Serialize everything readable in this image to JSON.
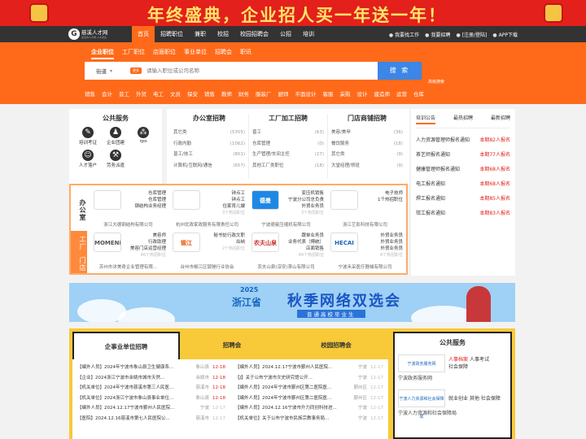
{
  "banner": {
    "text": "年终盛典，企业招人买一年送一年！"
  },
  "logo": {
    "title": "慈溪人才网",
    "slogan": "慈溪市人才网 人才就业"
  },
  "nav": [
    "首页",
    "招聘职位",
    "兼职",
    "校招",
    "校园招聘会",
    "公招",
    "培训"
  ],
  "user": [
    "我要找工作",
    "我要招聘",
    "[注册/登陆]",
    "APP下载"
  ],
  "search": {
    "tabs": [
      "企业职位",
      "工厂职位",
      "店面职位",
      "事业单位",
      "招聘会",
      "职讯"
    ],
    "city": "街道",
    "tag": "更多",
    "placeholder": "请输入职位或公司名称",
    "button": "搜 索",
    "advanced": "高级搜索"
  },
  "hotwords": [
    "销售",
    "会计",
    "普工",
    "外贸",
    "电工",
    "文员",
    "保安",
    "销售",
    "教师",
    "财务",
    "服装厂",
    "厨师",
    "平面设计",
    "客服",
    "采购",
    "设计",
    "建造师",
    "运营",
    "仓库"
  ],
  "publicService": {
    "title": "公共服务",
    "items": [
      "培训考证",
      "企业团建",
      "rpo",
      "人才落户",
      "劳务派遣"
    ]
  },
  "categories": [
    {
      "title": "办公室招聘",
      "items": [
        [
          "其它类",
          "(5355)"
        ],
        [
          "行政内勤",
          "(1062)"
        ],
        [
          "普工/技工",
          "(801)"
        ],
        [
          "计算机/互联网/通信",
          "(657)"
        ]
      ]
    },
    {
      "title": "工厂加工招聘",
      "items": [
        [
          "普工",
          "(63)"
        ],
        [
          "仓库管理",
          "(0)"
        ],
        [
          "生产管理/车间主任",
          "(27)"
        ],
        [
          "其他工厂类职位",
          "(18)"
        ]
      ]
    },
    {
      "title": "门店商铺招聘",
      "items": [
        [
          "美容/美甲",
          "(36)"
        ],
        [
          "餐饮服务",
          "(18)"
        ],
        [
          "其它类",
          "(9)"
        ],
        [
          "大堂经理/领班",
          "(9)"
        ]
      ]
    }
  ],
  "training": {
    "tabs": [
      "培训公告",
      "最热招聘",
      "最新招聘"
    ],
    "items": [
      [
        "人力资源管理师报名通知",
        "本期82人报名"
      ],
      [
        "茶艺师报名通知",
        "本期77人报名"
      ],
      [
        "健康管理师报名通知",
        "本期68人报名"
      ],
      [
        "电工报名通知",
        "本期68人报名"
      ],
      [
        "焊工报名通知",
        "本期85人报名"
      ],
      [
        "钳工报名通知",
        "本期83人报名"
      ]
    ]
  },
  "jobs": {
    "tabs": [
      "办公室",
      "工厂",
      "门店"
    ],
    "cards": [
      {
        "logo": "",
        "pos": [
          "仓库管理",
          "仓库管理",
          "钢结构业务经理"
        ],
        "hint": "",
        "co": "浙江大德钢结构有限公司"
      },
      {
        "logo": "",
        "pos": [
          "钟点工",
          "钟点工",
          "住家育儿嫂"
        ],
        "hint": "3个热招职位",
        "co": "杭州优政家政服务有限责任公司"
      },
      {
        "logo": "德曼",
        "pos": [
          "变压机销售",
          "宁波分公司总负责",
          "外贸业务员"
        ],
        "hint": "3个热招职位",
        "co": "宁波德曼压缩机有限公司"
      },
      {
        "logo": "",
        "pos": [
          "电子技师",
          "",
          "1个热招职位"
        ],
        "hint": "",
        "co": "浙江艺影科技有限公司"
      },
      {
        "logo": "MOMENI",
        "pos": [
          "美容师",
          "行政助理",
          "美容门店运营经理"
        ],
        "hint": "46个热招职位",
        "co": "苏州市沐美奇企业管理有限..."
      },
      {
        "logo": "锻江",
        "pos": [
          "秘书处行政文职",
          "出纳"
        ],
        "hint": "2个热招职位",
        "co": "台州市椒江区锻锤行业协会"
      },
      {
        "logo": "农夫山泉",
        "pos": [
          "跟单业务员",
          "业务代表（傅统）",
          "店面销售"
        ],
        "hint": "49个热招职位",
        "co": "农夫山泉(淳安)茶山有限公司"
      },
      {
        "logo": "HECAI",
        "pos": [
          "外贸业务员",
          "外贸业务员",
          "外贸业务员"
        ],
        "hint": "4个热招职位",
        "co": "宁波禾采医疗器械有限公司"
      }
    ]
  },
  "ad": {
    "year": "2025",
    "province": "浙江省",
    "title": "秋季网络双选会",
    "subtitle": "普通高校毕业生"
  },
  "news": {
    "tabs": [
      "企事业单位招聘",
      "招聘会",
      "校园招聘会"
    ],
    "left": [
      [
        "【编外人员】2024年宁波市象山县卫生健康系...",
        "象山县",
        "12-18"
      ],
      [
        "【企业】2024浙江宁波市余姚市城市天然...",
        "余姚市",
        "12-18"
      ],
      [
        "【机关单位】2024年宁波市慈溪市第三人民医...",
        "慈溪市",
        "12-18"
      ],
      [
        "【机关单位】2024浙江宁波市象山县事业单位...",
        "象山县",
        "12-18"
      ],
      [
        "【编外人员】2024.12.17宁波市鄞州人民医院...",
        "宁波",
        "12-17"
      ],
      [
        "【医院】2024.12.16慈溪市第七人民医院公...",
        "慈溪市",
        "12-17"
      ]
    ],
    "right": [
      [
        "【编外人员】2024.12.17宁波市鄞州人民医院...",
        "宁波",
        "12-17"
      ],
      [
        "【J】关于公布宁波市文史研究馆公开...",
        "宁波",
        "12-17"
      ],
      [
        "【编外人员】2024年宁波市鄞州区第二医院医...",
        "鄞州区",
        "12-17"
      ],
      [
        "【编外人员】2024年宁波市鄞州区第二医院医...",
        "鄞州区",
        "12-17"
      ],
      [
        "【编外人员】2024.12.16宁波市升力同创科技进...",
        "宁波",
        "12-17"
      ],
      [
        "【机关单位】关于公布宁波市民族宗教事务局...",
        "宁波",
        "12-17"
      ]
    ]
  },
  "psvc": {
    "title": "公共服务",
    "orgs": [
      {
        "logo": "宁波政务服务网",
        "links": [
          "人事档案",
          "人事考试",
          "社会保障"
        ],
        "name": "宁波政务服务网"
      },
      {
        "logo": "宁波人力资源和社会保障局",
        "links": [
          "就业创业",
          "其他",
          "社会保障"
        ],
        "name": "宁波人力资源和社会保障局"
      }
    ]
  }
}
